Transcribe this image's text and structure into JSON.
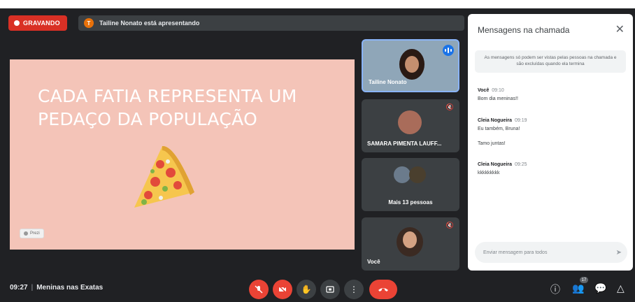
{
  "top": {
    "recording_label": "GRAVANDO",
    "presenter_initial": "T",
    "presenter_text": "Tailine Nonato está apresentando"
  },
  "slide": {
    "title_line1": "CADA FATIA REPRESENTA UM",
    "title_line2": "PEDAÇO DA POPULAÇÃO",
    "prezi_label": "Prezi",
    "pizza_icon": "pizza-slice-icon"
  },
  "tiles": [
    {
      "name": "Tailine Nonato",
      "icon": "speaking-indicator-icon"
    },
    {
      "name": "SAMARA PIMENTA LAUFF...",
      "icon": "mic-off-icon"
    },
    {
      "name": "Mais 13 pessoas"
    },
    {
      "name": "Você",
      "icon": "mic-off-icon"
    }
  ],
  "chat": {
    "title": "Mensagens na chamada",
    "notice": "As mensagens só podem ser vistas pelas pessoas na chamada e são excluídas quando ela termina",
    "messages": [
      {
        "sender": "Você",
        "time": "09:10",
        "text": "Bom dia meninas!!"
      },
      {
        "sender": "Cleia Nogueira",
        "time": "09:19",
        "text": "Eu também, Bruna!"
      },
      {
        "sender": "",
        "time": "",
        "text": "Tamo juntas!"
      },
      {
        "sender": "Cleia Nogueira",
        "time": "09:25",
        "text": "kkkkkkkkk"
      }
    ],
    "input_placeholder": "Enviar mensagem para todos"
  },
  "bottom": {
    "time": "09:27",
    "meeting_name": "Meninas nas Exatas",
    "participants_badge": "17"
  },
  "colors": {
    "background": "#202124",
    "recording_red": "#d93025",
    "slide_bg": "#f4c4b8",
    "accent_blue": "#8ab4f8"
  }
}
